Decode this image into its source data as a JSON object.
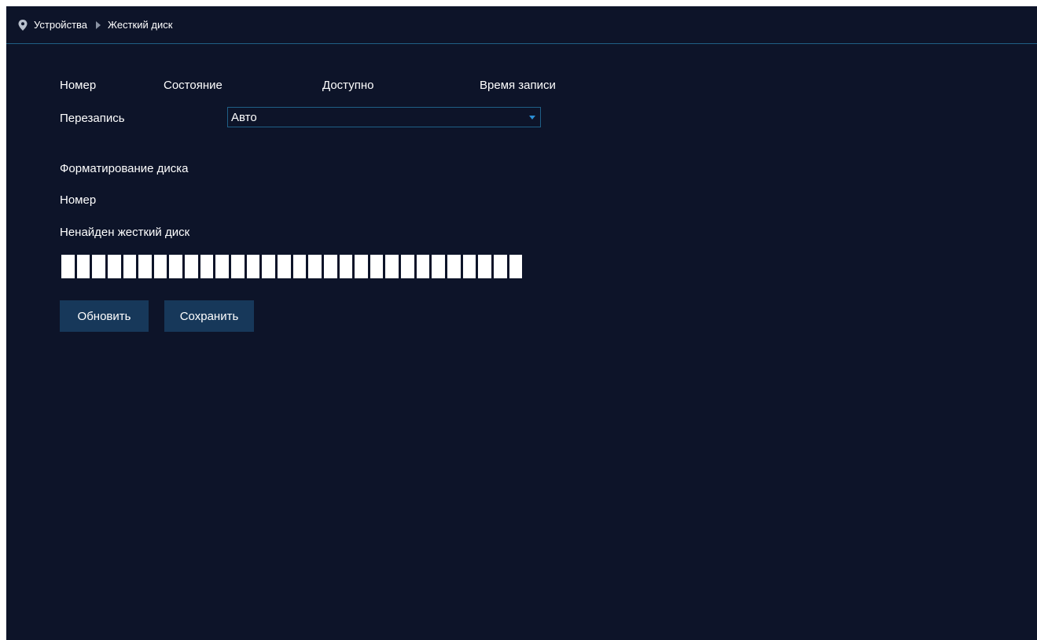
{
  "breadcrumb": {
    "items": [
      "Устройства",
      "Жесткий диск"
    ]
  },
  "table_header": {
    "columns": [
      "Номер",
      "Состояние",
      "Доступно",
      "Время записи"
    ]
  },
  "overwrite": {
    "label": "Перезапись",
    "selected": "Авто"
  },
  "format": {
    "title": "Форматирование диска",
    "number_label": "Номер",
    "status_text": "Ненайден жесткий диск",
    "progress_segments": 30
  },
  "buttons": {
    "refresh_label": "Обновить",
    "save_label": "Сохранить"
  },
  "colors": {
    "background": "#0d1429",
    "accent": "#1f5f86",
    "button": "#17385a",
    "dropdown_arrow": "#2b8fd6"
  },
  "icons": {
    "location": "location-pin-icon",
    "separator": "triangle-right-icon",
    "dropdown": "chevron-down-icon"
  }
}
